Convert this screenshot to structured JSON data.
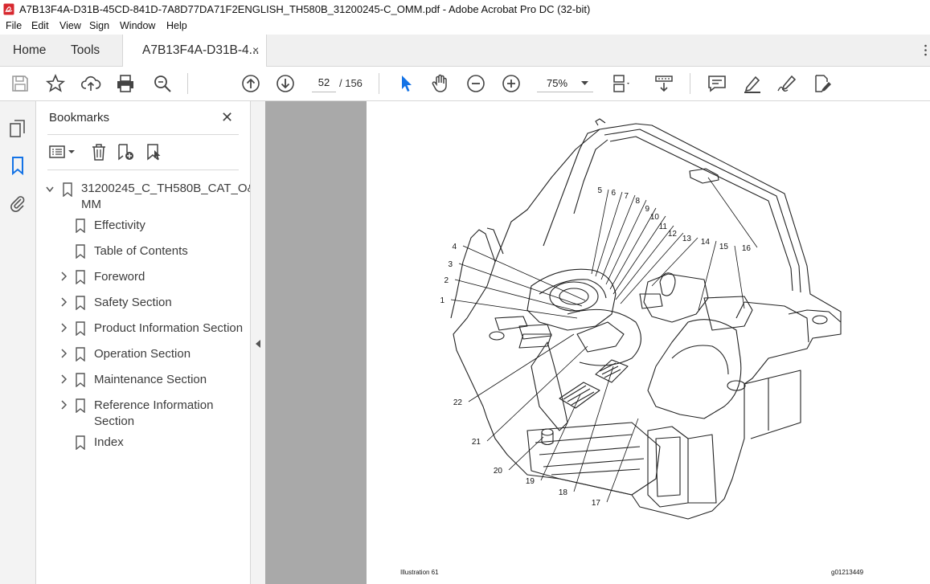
{
  "window": {
    "title": "A7B13F4A-D31B-45CD-841D-7A8D77DA71F2ENGLISH_TH580B_31200245-C_OMM.pdf - Adobe Acrobat Pro DC (32-bit)"
  },
  "menu": [
    "File",
    "Edit",
    "View",
    "Sign",
    "Window",
    "Help"
  ],
  "tabs": {
    "home": "Home",
    "tools": "Tools",
    "document": "A7B13F4A-D31B-4...",
    "close": "×"
  },
  "toolbar": {
    "page_current": "52",
    "page_total": "/  156",
    "zoom": "75%"
  },
  "bookmarks": {
    "title": "Bookmarks",
    "close": "✕",
    "root_line1": "31200245_C_TH580B_CAT_O&",
    "root_line2": "MM",
    "items": [
      {
        "label": "Effectivity",
        "expandable": false
      },
      {
        "label": "Table of Contents",
        "expandable": false
      },
      {
        "label": "Foreword",
        "expandable": true
      },
      {
        "label": "Safety Section",
        "expandable": true
      },
      {
        "label": "Product Information Section",
        "expandable": true
      },
      {
        "label": "Operation Section",
        "expandable": true
      },
      {
        "label": "Maintenance Section",
        "expandable": true
      },
      {
        "label": "Reference Information",
        "expandable": true
      },
      {
        "label": "Index",
        "expandable": false
      }
    ],
    "item_continuation": "Section"
  },
  "document": {
    "illustration_label": "Illustration 61",
    "graphic_id": "g01213449",
    "callouts": [
      "1",
      "2",
      "3",
      "4",
      "5",
      "6",
      "7",
      "8",
      "9",
      "10",
      "11",
      "12",
      "13",
      "14",
      "15",
      "16",
      "17",
      "18",
      "19",
      "20",
      "21",
      "22"
    ]
  },
  "colors": {
    "acrobat_red": "#d7282f",
    "selected_tool_blue": "#1473e6",
    "viewer_gray": "#a9a9a9"
  }
}
